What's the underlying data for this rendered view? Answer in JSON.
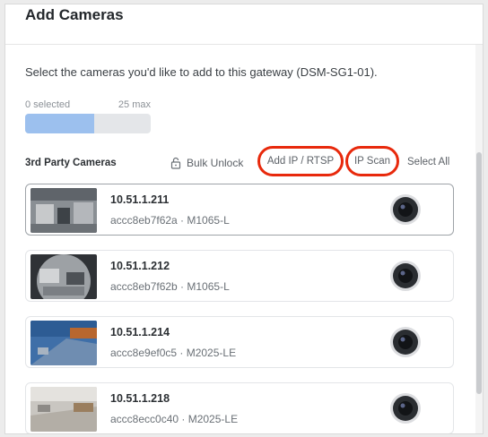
{
  "dialog": {
    "title": "Add Cameras",
    "intro": "Select the cameras you'd like to add to this gateway (DSM-SG1-01)."
  },
  "selection": {
    "min_label": "0 selected",
    "max_label": "25 max",
    "progress_fraction": 0.55
  },
  "toolbar": {
    "section_label": "3rd Party Cameras",
    "bulk_unlock": "Bulk Unlock",
    "add_ip": "Add IP / RTSP",
    "ip_scan": "IP Scan",
    "select_all": "Select All"
  },
  "cameras": [
    {
      "ip": "10.51.1.211",
      "meta": "accc8eb7f62a · M1065-L"
    },
    {
      "ip": "10.51.1.212",
      "meta": "accc8eb7f62b · M1065-L"
    },
    {
      "ip": "10.51.1.214",
      "meta": "accc8e9ef0c5 · M2025-LE"
    },
    {
      "ip": "10.51.1.218",
      "meta": "accc8ecc0c40 · M2025-LE"
    }
  ],
  "colors": {
    "accent_highlight": "#e8290c",
    "progress_fill": "#9cc0ee"
  }
}
